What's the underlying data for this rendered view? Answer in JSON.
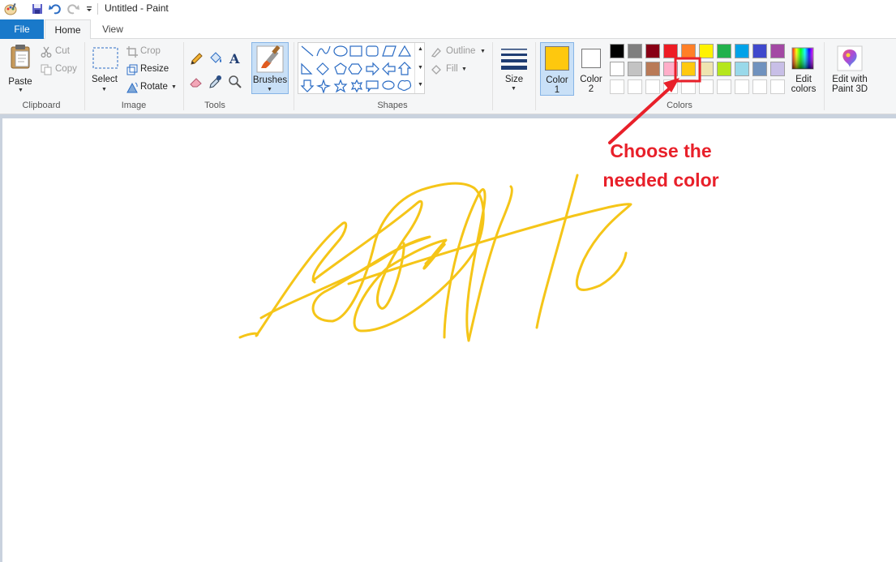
{
  "window": {
    "title": "Untitled - Paint"
  },
  "quick_access": [
    "paint-app-icon",
    "save-icon",
    "undo-icon",
    "redo-icon",
    "customize-dropdown-icon"
  ],
  "tabs": [
    {
      "label": "File",
      "active": false
    },
    {
      "label": "Home",
      "active": true
    },
    {
      "label": "View",
      "active": false
    }
  ],
  "clipboard": {
    "paste": "Paste",
    "cut": "Cut",
    "copy": "Copy",
    "group": "Clipboard"
  },
  "image": {
    "select": "Select",
    "crop": "Crop",
    "resize": "Resize",
    "rotate": "Rotate",
    "group": "Image"
  },
  "tools": {
    "group": "Tools"
  },
  "brushes": {
    "label": "Brushes"
  },
  "shapes": {
    "outline": "Outline",
    "fill": "Fill",
    "group": "Shapes"
  },
  "size": {
    "label": "Size"
  },
  "colors": {
    "group": "Colors",
    "color1_label": "Color",
    "color1_num": "1",
    "color2_label": "Color",
    "color2_num": "2",
    "color1_value": "#fec80e",
    "color2_value": "#ffffff",
    "edit_line1": "Edit",
    "edit_line2": "colors",
    "palette_row1": [
      "#000000",
      "#7f7f7f",
      "#880015",
      "#ed1c24",
      "#ff7f27",
      "#fff200",
      "#22b14c",
      "#00a2e8",
      "#3f48cc",
      "#a349a4"
    ],
    "palette_row2": [
      "#ffffff",
      "#c3c3c3",
      "#b97a57",
      "#ffaec9",
      "#ffc90e",
      "#efe4b0",
      "#b5e61d",
      "#99d9ea",
      "#7092be",
      "#c8bfe7"
    ],
    "highlighted_swatch": "#ffc90e"
  },
  "paint3d": {
    "line1": "Edit with",
    "line2": "Paint 3D"
  },
  "annotation": {
    "line1": "Choose the",
    "line2": "needed color",
    "color": "#e8202a"
  },
  "scribble_color": "#f5c518"
}
